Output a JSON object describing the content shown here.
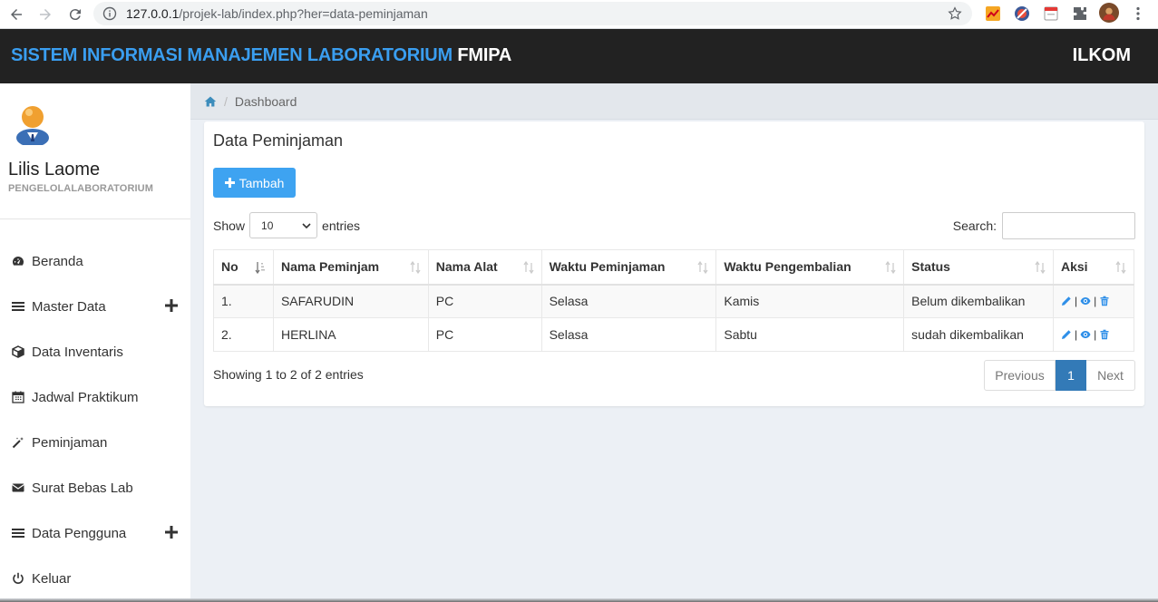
{
  "browser": {
    "url_host": "127.0.0.1",
    "url_path": "/projek-lab/index.php?her=data-peminjaman"
  },
  "header": {
    "brand_primary": "SISTEM INFORMASI MANAJEMEN LABORATORIUM",
    "brand_secondary": "FMIPA",
    "right_label": "ILKOM",
    "brand_color": "#3a9ef0",
    "header_bg": "#222222"
  },
  "sidebar": {
    "user_name": "Lilis Laome",
    "user_role": "PENGELOLALABORATORIUM",
    "items": [
      {
        "label": "Beranda",
        "icon": "dashboard-icon",
        "name": "sidebar-item-beranda",
        "expandable": false
      },
      {
        "label": "Master Data",
        "icon": "bars-icon",
        "name": "sidebar-item-master-data",
        "expandable": true
      },
      {
        "label": "Data Inventaris",
        "icon": "cube-icon",
        "name": "sidebar-item-data-inventaris",
        "expandable": false
      },
      {
        "label": "Jadwal Praktikum",
        "icon": "calendar-icon",
        "name": "sidebar-item-jadwal-praktikum",
        "expandable": false
      },
      {
        "label": "Peminjaman",
        "icon": "magic-wand-icon",
        "name": "sidebar-item-peminjaman",
        "expandable": false
      },
      {
        "label": "Surat Bebas Lab",
        "icon": "envelope-icon",
        "name": "sidebar-item-surat-bebas-lab",
        "expandable": false
      },
      {
        "label": "Data Pengguna",
        "icon": "bars-icon",
        "name": "sidebar-item-data-pengguna",
        "expandable": true
      },
      {
        "label": "Keluar",
        "icon": "power-icon",
        "name": "sidebar-item-keluar",
        "expandable": false
      }
    ]
  },
  "breadcrumb": {
    "current": "Dashboard"
  },
  "panel": {
    "title": "Data Peminjaman",
    "add_button": "Tambah",
    "show_label": "Show",
    "entries_label": "entries",
    "page_length": "10",
    "search_label": "Search:",
    "search_value": ""
  },
  "table": {
    "columns": [
      "No",
      "Nama Peminjam",
      "Nama Alat",
      "Waktu Peminjaman",
      "Waktu Pengembalian",
      "Status",
      "Aksi"
    ],
    "rows": [
      {
        "no": "1.",
        "nama_peminjam": "SAFARUDIN",
        "nama_alat": "PC",
        "waktu_peminjaman": "Selasa",
        "waktu_pengembalian": "Kamis",
        "status": "Belum dikembalikan"
      },
      {
        "no": "2.",
        "nama_peminjam": "HERLINA",
        "nama_alat": "PC",
        "waktu_peminjaman": "Selasa",
        "waktu_pengembalian": "Sabtu",
        "status": "sudah dikembalikan"
      }
    ],
    "action_separator": "|"
  },
  "footer": {
    "info": "Showing 1 to 2 of 2 entries",
    "prev_label": "Previous",
    "current_page": "1",
    "next_label": "Next"
  },
  "colors": {
    "accent": "#3ea3f1",
    "pager_active": "#337ab7",
    "action_icon": "#2f8fe8"
  }
}
